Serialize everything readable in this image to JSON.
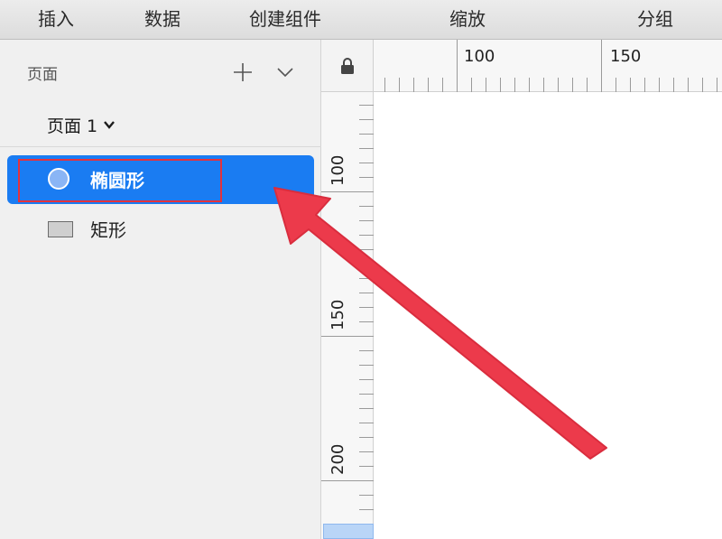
{
  "toolbar": {
    "items": [
      "插入",
      "数据",
      "创建组件",
      "缩放",
      "分组"
    ]
  },
  "sidebar": {
    "pages_title": "页面",
    "page_selector": "页面 1",
    "layers": [
      {
        "label": "椭圆形",
        "icon": "oval-icon",
        "selected": true
      },
      {
        "label": "矩形",
        "icon": "rectangle-icon",
        "selected": false
      }
    ]
  },
  "rulers": {
    "horizontal": [
      "100",
      "150"
    ],
    "vertical": [
      "100",
      "150",
      "200"
    ]
  },
  "colors": {
    "selection": "#1a7cf2",
    "annotation": "#e5323c"
  }
}
